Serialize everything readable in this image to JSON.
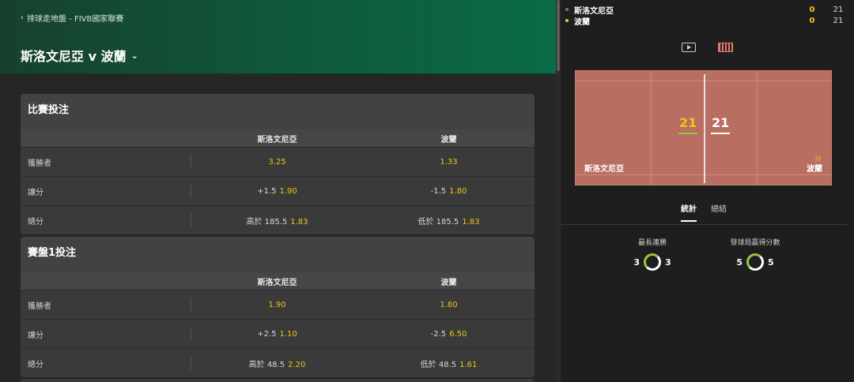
{
  "header": {
    "breadcrumb": "排球走地盤 - FIVB國家聯賽",
    "match_title": "斯洛文尼亞 v 波蘭"
  },
  "markets": [
    {
      "title": "比賽投注",
      "team1": "斯洛文尼亞",
      "team2": "波蘭",
      "rows": [
        {
          "label": "獲勝者",
          "t1_prefix": "",
          "t1_odd": "3.25",
          "t2_prefix": "",
          "t2_odd": "1.33"
        },
        {
          "label": "讓分",
          "t1_prefix": "+1.5",
          "t1_odd": "1.90",
          "t2_prefix": "-1.5",
          "t2_odd": "1.80"
        },
        {
          "label": "總分",
          "t1_prefix": "高於 185.5",
          "t1_odd": "1.83",
          "t2_prefix": "低於 185.5",
          "t2_odd": "1.83"
        }
      ]
    },
    {
      "title": "賽盤1投注",
      "team1": "斯洛文尼亞",
      "team2": "波蘭",
      "rows": [
        {
          "label": "獲勝者",
          "t1_prefix": "",
          "t1_odd": "1.90",
          "t2_prefix": "",
          "t2_odd": "1.80"
        },
        {
          "label": "讓分",
          "t1_prefix": "+2.5",
          "t1_odd": "1.10",
          "t2_prefix": "-2.5",
          "t2_odd": "6.50"
        },
        {
          "label": "總分",
          "t1_prefix": "高於 48.5",
          "t1_odd": "2.20",
          "t2_prefix": "低於 48.5",
          "t2_odd": "1.61"
        }
      ]
    }
  ],
  "scoreboard": {
    "team1": {
      "name": "斯洛文尼亞",
      "sets": "0",
      "points": "21"
    },
    "team2": {
      "name": "波蘭",
      "sets": "0",
      "points": "21"
    }
  },
  "court": {
    "score_left": "21",
    "score_right": "21",
    "team_left": "斯洛文尼亞",
    "team_right": "波蘭",
    "points_label": "分"
  },
  "tabs": [
    "統計",
    "總結"
  ],
  "stats": [
    {
      "label": "最長連勝",
      "left": "3",
      "right": "3"
    },
    {
      "label": "發球局贏得分數",
      "left": "5",
      "right": "5"
    }
  ],
  "icons": {
    "play": "play-icon",
    "court": "court-icon",
    "back": "chevron-left-icon",
    "dropdown": "chevron-down-icon"
  },
  "colors": {
    "odds": "#f0c419",
    "header_green": "#0f5a3c",
    "court": "#b86e61",
    "ring": "#9bc53d"
  }
}
